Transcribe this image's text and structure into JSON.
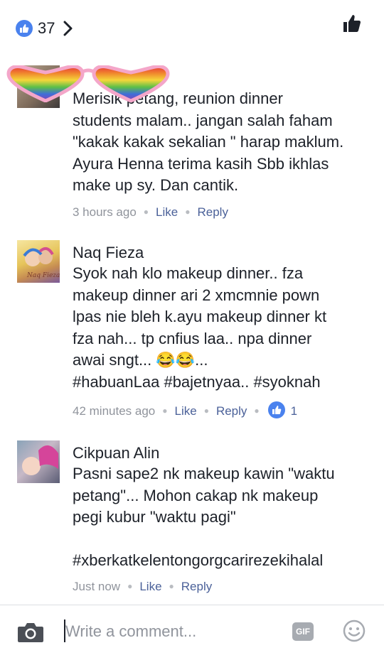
{
  "header": {
    "like_count": "37"
  },
  "comments": [
    {
      "author": "",
      "lines": [
        "Merisik petang, reunion dinner",
        "students malam.. jangan salah faham",
        "\"kakak kakak sekalian \" harap maklum."
      ],
      "mention": "Ayura Henna",
      "mention_rest": " terima kasih Sbb ikhlas",
      "lines_after": [
        "make up sy. Dan cantik."
      ],
      "time": "3 hours ago",
      "like_label": "Like",
      "reply_label": "Reply"
    },
    {
      "author": "Naq Fieza",
      "lines": [
        "Syok nah klo makeup dinner.. fza",
        "makeup dinner ari 2 xmcmnie pown",
        "lpas nie bleh k.ayu makeup dinner kt",
        "fza nah... tp cnfius laa.. npa dinner",
        "awai sngt... 😂😂...",
        "#habuanLaa #bajetnyaa.. #syoknah"
      ],
      "time": "42 minutes ago",
      "like_label": "Like",
      "reply_label": "Reply",
      "reaction_count": "1"
    },
    {
      "author": "Cikpuan Alin",
      "lines": [
        "Pasni sape2 nk makeup kawin \"waktu",
        "petang\"... Mohon cakap nk makeup",
        "pegi kubur \"waktu pagi\"",
        "",
        "#xberkatkelentongorgcarirezekihalal"
      ],
      "time": "Just now",
      "like_label": "Like",
      "reply_label": "Reply"
    }
  ],
  "composer": {
    "placeholder": "Write a comment...",
    "gif_label": "GIF"
  },
  "colors": {
    "accent": "#4a82ee",
    "link": "#4b6199",
    "muted": "#90949c"
  },
  "icons": [
    "like-icon",
    "chevron-right-icon",
    "thumbs-up-icon",
    "camera-icon",
    "gif-icon",
    "emoji-icon"
  ]
}
